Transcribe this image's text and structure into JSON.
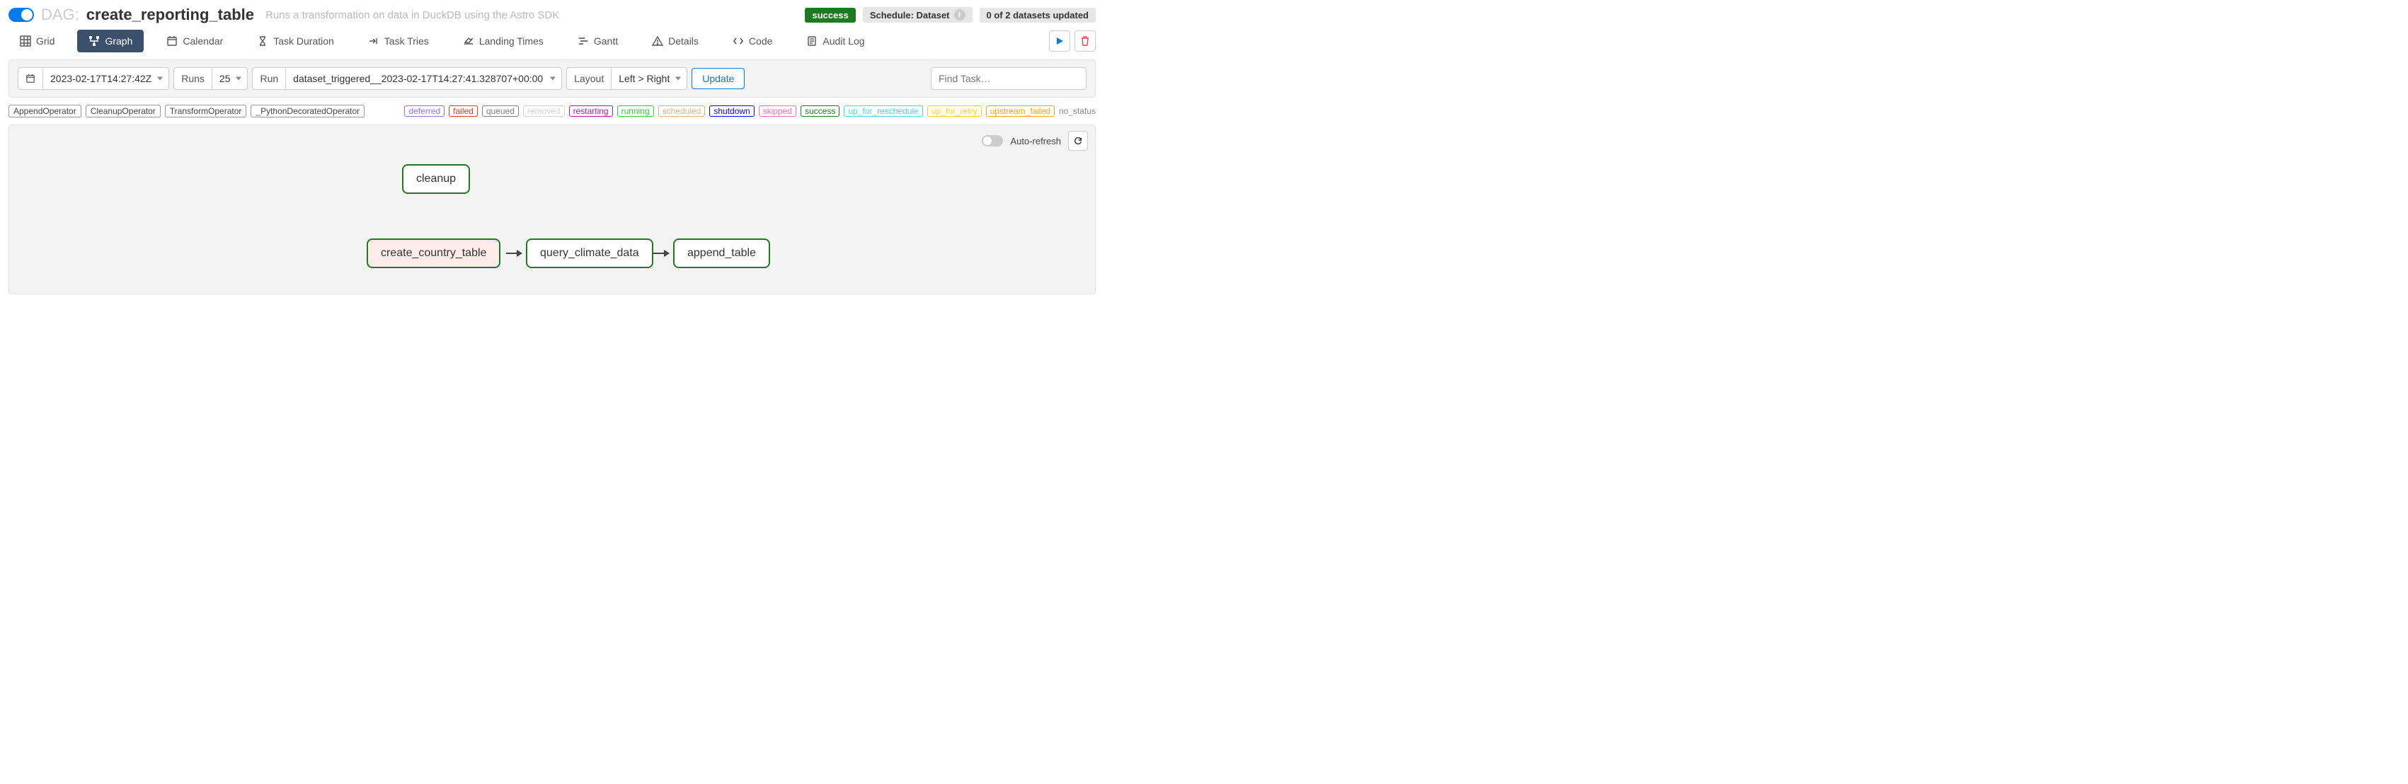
{
  "header": {
    "dag_label": "DAG:",
    "dag_name": "create_reporting_table",
    "description": "Runs a transformation on data in DuckDB using the Astro SDK",
    "status_badge": "success",
    "schedule_label": "Schedule: Dataset",
    "dataset_status": "0 of 2 datasets updated"
  },
  "tabs": {
    "grid": "Grid",
    "graph": "Graph",
    "calendar": "Calendar",
    "task_duration": "Task Duration",
    "task_tries": "Task Tries",
    "landing_times": "Landing Times",
    "gantt": "Gantt",
    "details": "Details",
    "code": "Code",
    "audit_log": "Audit Log"
  },
  "filters": {
    "base_date": "2023-02-17T14:27:42Z",
    "runs_label": "Runs",
    "runs_value": "25",
    "run_label": "Run",
    "run_value": "dataset_triggered__2023-02-17T14:27:41.328707+00:00",
    "layout_label": "Layout",
    "layout_value": "Left > Right",
    "update_label": "Update",
    "find_task_placeholder": "Find Task…"
  },
  "operators": {
    "append": "AppendOperator",
    "cleanup": "CleanupOperator",
    "transform": "TransformOperator",
    "python": "_PythonDecoratedOperator"
  },
  "statuses": {
    "deferred": "deferred",
    "failed": "failed",
    "queued": "queued",
    "removed": "removed",
    "restarting": "restarting",
    "running": "running",
    "scheduled": "scheduled",
    "shutdown": "shutdown",
    "skipped": "skipped",
    "success": "success",
    "up_for_reschedule": "up_for_reschedule",
    "up_for_retry": "up_for_retry",
    "upstream_failed": "upstream_failed",
    "no_status": "no_status"
  },
  "graph": {
    "auto_refresh_label": "Auto-refresh",
    "nodes": {
      "cleanup": "cleanup",
      "create_country_table": "create_country_table",
      "query_climate_data": "query_climate_data",
      "append_table": "append_table"
    }
  },
  "colors": {
    "deferred": "#9370db",
    "failed": "#e03b24",
    "queued": "#808080",
    "removed": "#d3d3d3",
    "restarting": "#c71585",
    "running": "#32cd32",
    "scheduled": "#d2b48c",
    "shutdown": "#0000ff",
    "skipped": "#ff69b4",
    "success": "#1f7a1f",
    "up_for_reschedule": "#40e0d0",
    "up_for_retry": "#ffd700",
    "upstream_failed": "#ffa500"
  }
}
